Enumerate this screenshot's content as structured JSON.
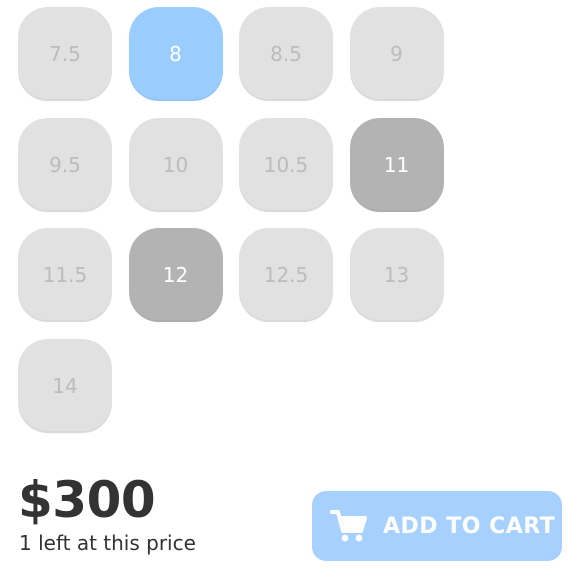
{
  "sizes": [
    {
      "label": "7.5",
      "state": "unavailable"
    },
    {
      "label": "8",
      "state": "selected"
    },
    {
      "label": "8.5",
      "state": "unavailable"
    },
    {
      "label": "9",
      "state": "unavailable"
    },
    {
      "label": "9.5",
      "state": "unavailable"
    },
    {
      "label": "10",
      "state": "unavailable"
    },
    {
      "label": "10.5",
      "state": "unavailable"
    },
    {
      "label": "11",
      "state": "available"
    },
    {
      "label": "11.5",
      "state": "unavailable"
    },
    {
      "label": "12",
      "state": "available"
    },
    {
      "label": "12.5",
      "state": "unavailable"
    },
    {
      "label": "13",
      "state": "unavailable"
    },
    {
      "label": "14",
      "state": "unavailable"
    }
  ],
  "price": "$300",
  "stock_note": "1 left at this price",
  "cart": {
    "label": "ADD TO CART",
    "icon": "shopping-cart-icon"
  },
  "colors": {
    "selected": "#99ccff",
    "available": "#b3b3b3",
    "unavailable": "#e1e1e1",
    "cart_button": "#a6d1ff",
    "price_text": "#333333"
  }
}
